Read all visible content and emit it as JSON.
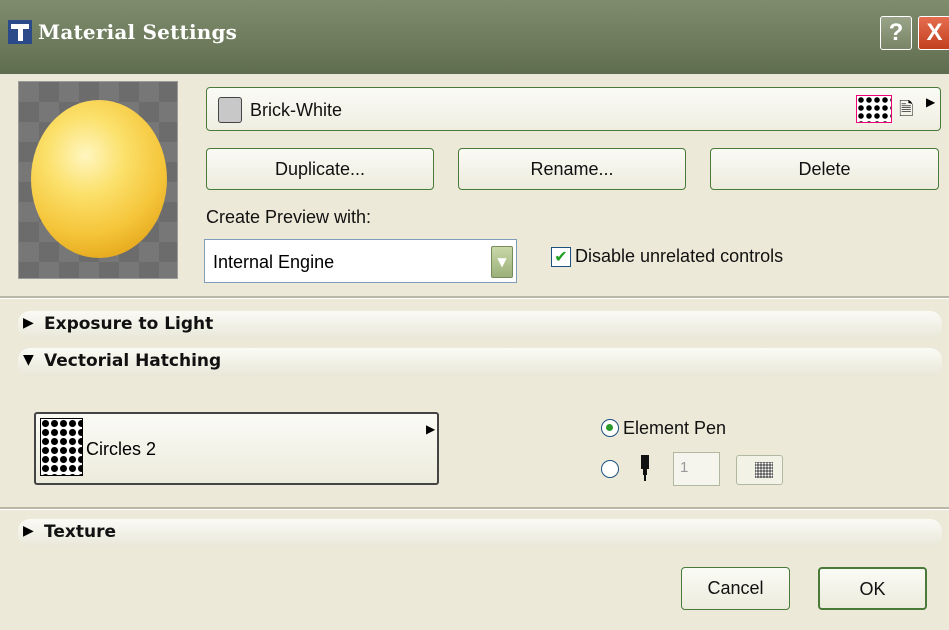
{
  "window": {
    "title": "Material Settings",
    "help_label": "?",
    "close_label": "X"
  },
  "material": {
    "name": "Brick-White",
    "duplicate_label": "Duplicate...",
    "rename_label": "Rename...",
    "delete_label": "Delete"
  },
  "preview": {
    "create_label": "Create Preview with:",
    "engine_value": "Internal Engine",
    "disable_label": "Disable unrelated controls",
    "disable_checked": true
  },
  "sections": {
    "exposure": "Exposure to Light",
    "hatching": "Vectorial Hatching",
    "texture": "Texture"
  },
  "hatching": {
    "pattern_name": "Circles 2",
    "element_pen_label": "Element Pen",
    "pen_number": "1"
  },
  "footer": {
    "cancel_label": "Cancel",
    "ok_label": "OK"
  },
  "colors": {
    "title_bar": "#6d7b5c",
    "button_border": "#4a7a3a",
    "check_green": "#21a121"
  }
}
